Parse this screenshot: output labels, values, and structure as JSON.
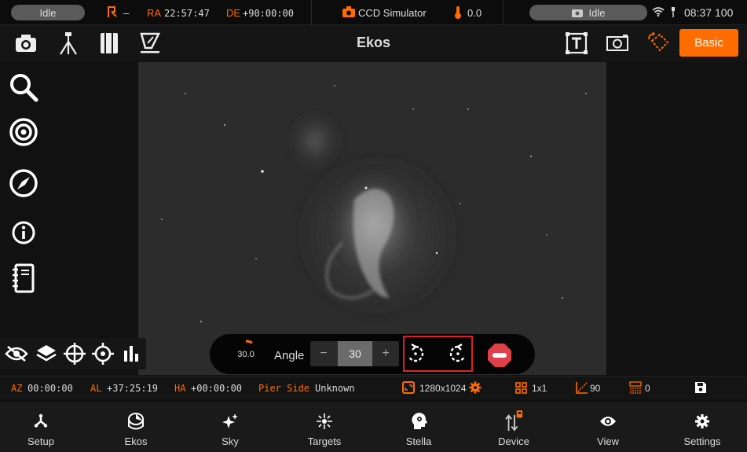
{
  "status": {
    "left_pill": "Idle",
    "ra_label": "RA",
    "ra_value": "22:57:47",
    "de_label": "DE",
    "de_value": "+90:00:00",
    "dash": "–",
    "camera": "CCD Simulator",
    "temperature": "0.0",
    "right_pill": "Idle",
    "clock": "08:37",
    "battery": "100"
  },
  "toolbar": {
    "title": "Ekos",
    "basic_label": "Basic"
  },
  "rotation": {
    "dial_value": "30.0",
    "angle_label": "Angle",
    "angle_value": "30",
    "minus": "−",
    "plus": "+"
  },
  "info": {
    "az_label": "AZ",
    "az_value": "00:00:00",
    "al_label": "AL",
    "al_value": "+37:25:19",
    "ha_label": "HA",
    "ha_value": "+00:00:00",
    "pier_label": "Pier Side",
    "pier_value": "Unknown",
    "resolution": "1280x1024",
    "binning": "1x1",
    "gain": "90",
    "offset": "0"
  },
  "nav": [
    {
      "label": "Setup"
    },
    {
      "label": "Ekos"
    },
    {
      "label": "Sky"
    },
    {
      "label": "Targets"
    },
    {
      "label": "Stella"
    },
    {
      "label": "Device"
    },
    {
      "label": "View"
    },
    {
      "label": "Settings"
    }
  ],
  "colors": {
    "accent": "#ff6d00",
    "highlight_box": "#dd2222",
    "stop": "#e0404a"
  }
}
